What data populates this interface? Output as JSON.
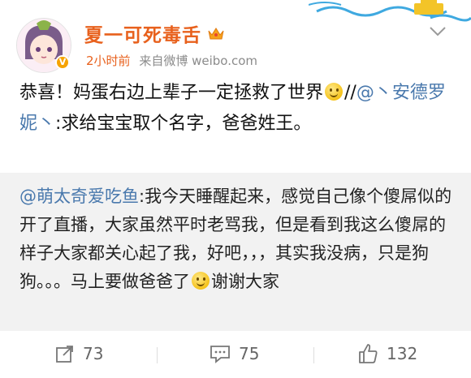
{
  "user": {
    "name": "夏一可死毒舌",
    "vip_badge": "V",
    "time": "2小时前",
    "source": "来自微博 weibo.com"
  },
  "post": {
    "part1": "恭喜！妈蛋右边上辈子一定拯救了世界",
    "slashes": "//",
    "mention": "@丶安德罗妮丶",
    "part2": ":求给宝宝取个名字，爸爸姓王。"
  },
  "repost": {
    "mention": "@萌太奇爱吃鱼",
    "part1": ":我今天睡醒起来，感觉自己像个傻屌似的开了直播，大家虽然平时老骂我，但是看到我这么傻屌的样子大家都关心起了我，好吧，，，其实我没病，只是狗狗。。。马上要做爸爸了",
    "part2": "谢谢大家"
  },
  "actions": {
    "repost_count": "73",
    "comment_count": "75",
    "like_count": "132"
  },
  "icons": [
    "avatar",
    "crown-icon",
    "chevron-down-icon",
    "smiley-emoji-icon",
    "repost-icon",
    "comment-icon",
    "like-icon"
  ],
  "colors": {
    "username": "#e8611d",
    "link": "#4a79ad",
    "meta": "#8b8b8b",
    "repost_bg": "#f2f2f2"
  }
}
